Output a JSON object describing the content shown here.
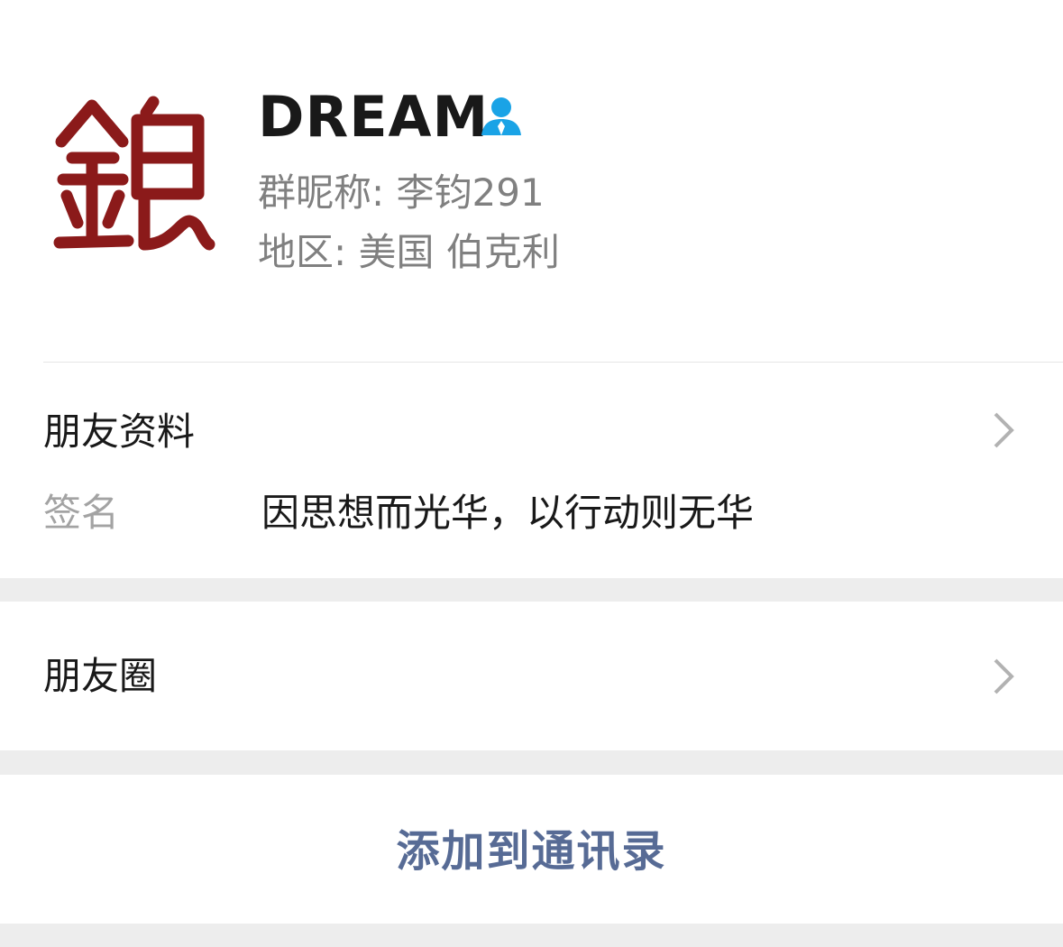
{
  "profile": {
    "avatar_label": "avatar",
    "nickname": "DREAM",
    "contact_icon": "contact-person-icon",
    "group_nickname": "群昵称: 李钧291",
    "region": "地区: 美国 伯克利"
  },
  "friend_info": {
    "title": "朋友资料",
    "signature_label": "签名",
    "signature_value": "因思想而光华，以行动则无华"
  },
  "moments": {
    "title": "朋友圈"
  },
  "actions": {
    "add_to_contacts": "添加到通讯录"
  },
  "colors": {
    "link_blue": "#576b95",
    "contact_icon_blue": "#1aa3e6",
    "seal_red": "#8b1a1a",
    "background": "#ededed"
  }
}
